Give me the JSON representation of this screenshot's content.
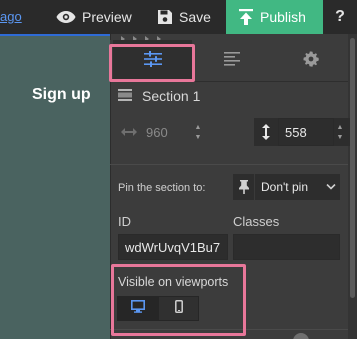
{
  "topbar": {
    "link_text": "ago",
    "preview_label": "Preview",
    "save_label": "Save",
    "publish_label": "Publish",
    "help_label": "?"
  },
  "canvas": {
    "heading": "Sign up"
  },
  "panel": {
    "tabs": [
      {
        "icon": "sliders-icon",
        "active": true
      },
      {
        "icon": "align-left-icon",
        "active": false
      },
      {
        "icon": "gear-icon",
        "active": false
      }
    ],
    "section_title": "Section 1",
    "width_value": "960",
    "height_value": "558",
    "pin_label": "Pin the section to:",
    "pin_value": "Don't pin",
    "id_label": "ID",
    "id_value": "wdWrUvqV1Bu7",
    "classes_label": "Classes",
    "classes_value": "",
    "viewports_label": "Visible on viewports",
    "viewports": [
      {
        "icon": "desktop-icon",
        "active": true
      },
      {
        "icon": "mobile-icon",
        "active": false
      }
    ]
  },
  "colors": {
    "canvas_bg": "#4a6360",
    "panel_bg": "#3c3c3c",
    "publish_bg": "#41b883",
    "highlight": "#e8779a",
    "accent_blue": "#5b97f2"
  }
}
